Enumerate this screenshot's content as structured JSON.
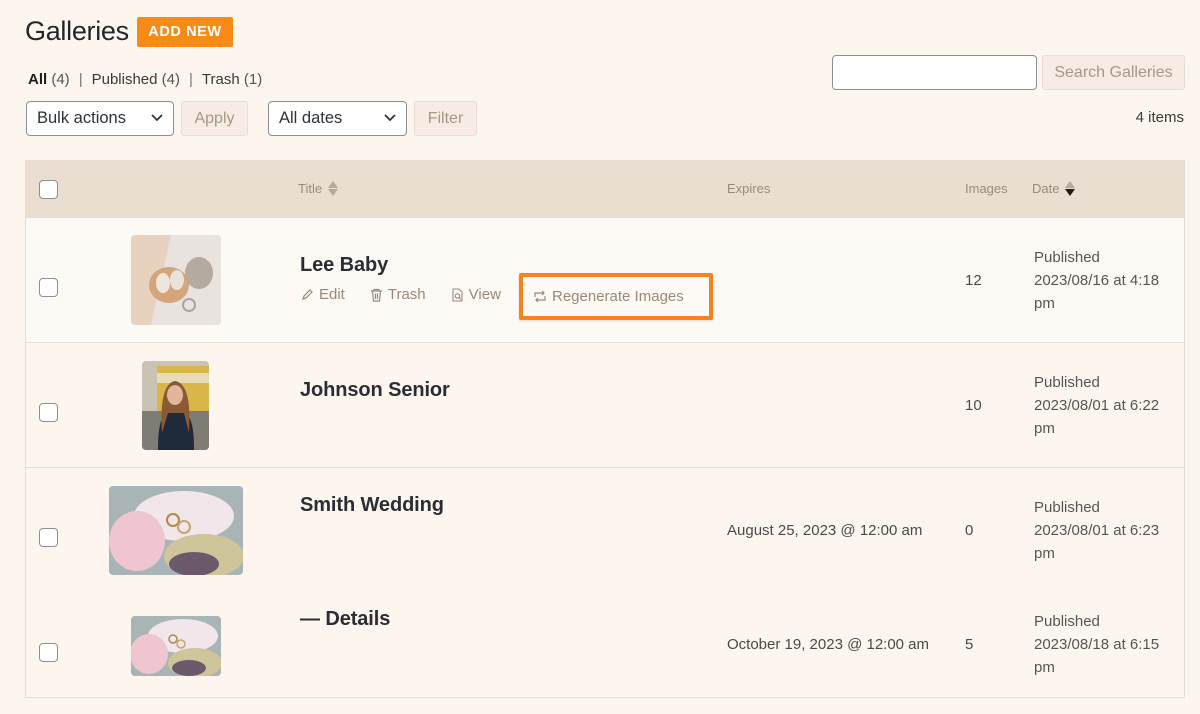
{
  "header": {
    "title": "Galleries",
    "add_new_label": "ADD NEW",
    "accent_color": "#f88a16"
  },
  "views": [
    {
      "label": "All",
      "count": "(4)",
      "current": true
    },
    {
      "label": "Published",
      "count": "(4)",
      "current": false
    },
    {
      "label": "Trash",
      "count": "(1)",
      "current": false
    }
  ],
  "toolbar": {
    "bulk_actions": "Bulk actions",
    "apply_label": "Apply",
    "dates_filter": "All dates",
    "filter_label": "Filter",
    "search_value": "",
    "search_button": "Search Galleries",
    "items_count": "4 items"
  },
  "table": {
    "columns": {
      "title": "Title",
      "expires": "Expires",
      "images": "Images",
      "date": "Date"
    },
    "rows": [
      {
        "title": "Lee Baby",
        "expires": "",
        "images": "12",
        "status": "Published",
        "date": "2023/08/16 at 4:18",
        "date_suffix": "pm",
        "thumbnail": "baby-shoes-photo",
        "actions": {
          "edit": "Edit",
          "trash": "Trash",
          "view": "View",
          "regenerate": "Regenerate Images"
        }
      },
      {
        "title": "Johnson Senior",
        "expires": "",
        "images": "10",
        "status": "Published",
        "date": "2023/08/01 at 6:22",
        "date_suffix": "pm",
        "thumbnail": "senior-portrait-photo"
      },
      {
        "title": "Smith Wedding",
        "expires": "August 25, 2023 @ 12:00 am",
        "images": "0",
        "status": "Published",
        "date": "2023/08/01 at 6:23",
        "date_suffix": "pm",
        "thumbnail": "wedding-rings-flowers-photo"
      },
      {
        "title": "— Details",
        "expires": "October 19, 2023 @ 12:00 am",
        "images": "5",
        "status": "Published",
        "date": "2023/08/18 at 6:15",
        "date_suffix": "pm",
        "thumbnail": "wedding-rings-flowers-photo"
      }
    ]
  }
}
